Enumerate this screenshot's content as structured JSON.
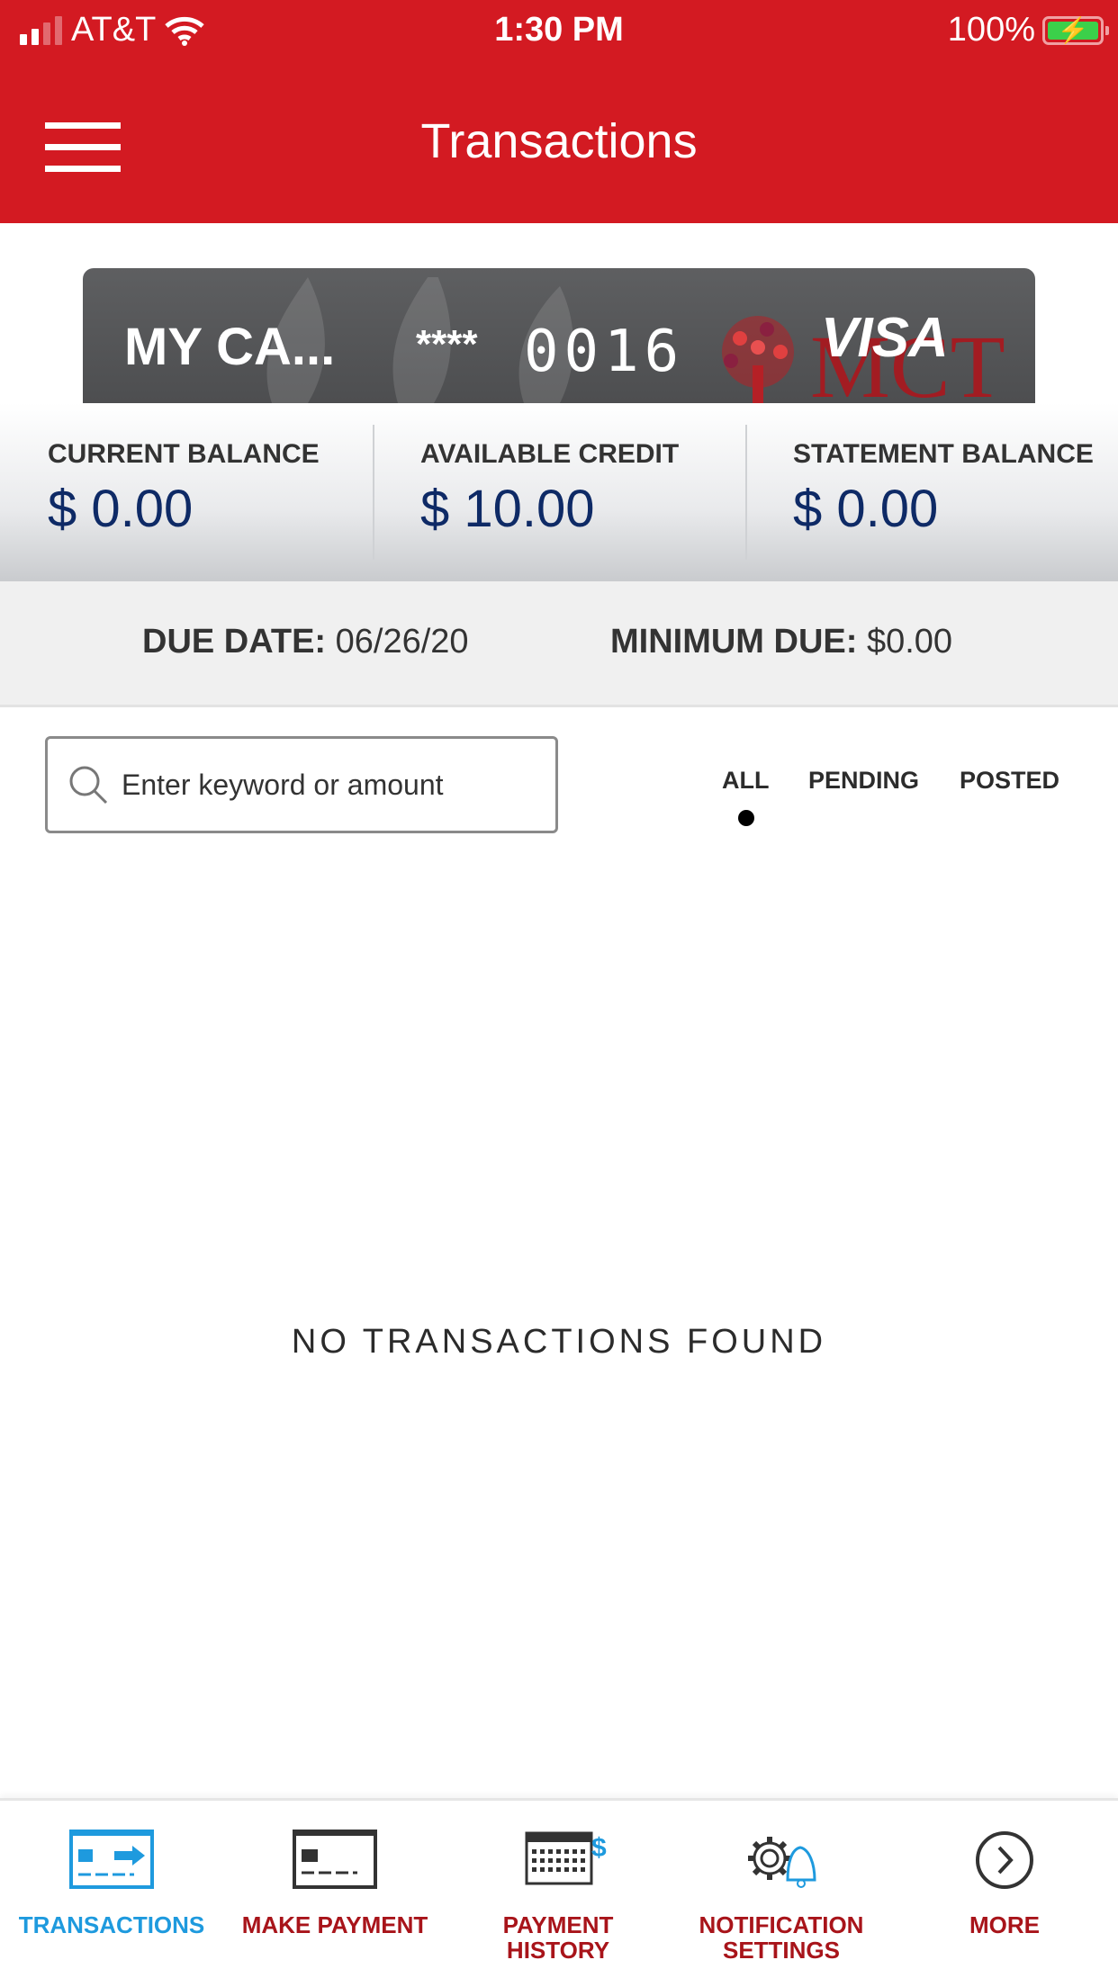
{
  "status_bar": {
    "carrier": "AT&T",
    "time": "1:30 PM",
    "battery": "100%"
  },
  "header": {
    "title": "Transactions"
  },
  "card": {
    "name": "MY CA...",
    "mask": "****",
    "last_digits": "0016",
    "network": "VISA",
    "issuer_logo": "MCT"
  },
  "balances": [
    {
      "label": "CURRENT BALANCE",
      "value": "$ 0.00"
    },
    {
      "label": "AVAILABLE CREDIT",
      "value": "$ 10.00"
    },
    {
      "label": "STATEMENT BALANCE",
      "value": "$ 0.00"
    }
  ],
  "due": {
    "date_label": "DUE DATE:",
    "date_value": "06/26/20",
    "min_label": "MINIMUM DUE:",
    "min_value": "$0.00"
  },
  "search": {
    "placeholder": "Enter keyword or amount",
    "value": ""
  },
  "filters": {
    "items": [
      "ALL",
      "PENDING",
      "POSTED"
    ],
    "active": "ALL"
  },
  "empty_message": "NO TRANSACTIONS FOUND",
  "tabbar": {
    "items": [
      {
        "label": "TRANSACTIONS",
        "icon": "transactions-icon",
        "active": true
      },
      {
        "label": "MAKE PAYMENT",
        "icon": "make-payment-icon",
        "active": false
      },
      {
        "label": "PAYMENT\nHISTORY",
        "icon": "payment-history-icon",
        "active": false
      },
      {
        "label": "NOTIFICATION\nSETTINGS",
        "icon": "notification-settings-icon",
        "active": false
      },
      {
        "label": "MORE",
        "icon": "more-icon",
        "active": false
      }
    ]
  },
  "colors": {
    "brand_red": "#d31a22",
    "tab_label_red": "#a8141a",
    "active_blue": "#1e9ade",
    "balance_blue": "#0e2a66",
    "battery_green": "#3bd04a"
  }
}
